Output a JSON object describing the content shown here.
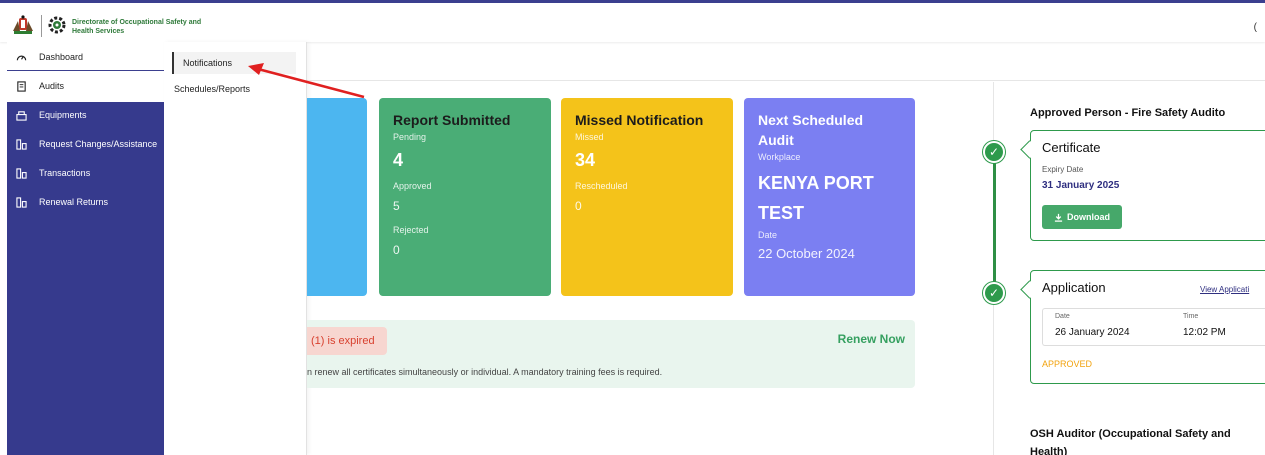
{
  "header": {
    "org_name": "Directorate of Occupational Safety and Health Services",
    "right_mark": "("
  },
  "sidebar": {
    "items": [
      {
        "label": "Dashboard",
        "icon": "gauge-icon"
      },
      {
        "label": "Audits",
        "icon": "document-icon"
      },
      {
        "label": "Equipments",
        "icon": "equipment-icon"
      },
      {
        "label": "Request Changes/Assistance",
        "icon": "request-icon"
      },
      {
        "label": "Transactions",
        "icon": "transactions-icon"
      },
      {
        "label": "Renewal Returns",
        "icon": "renewal-icon"
      }
    ]
  },
  "flyout": {
    "items": [
      "Notifications",
      "Schedules/Reports"
    ]
  },
  "cards": {
    "report": {
      "title": "Report Submitted",
      "pending_label": "Pending",
      "pending_value": "4",
      "approved_label": "Approved",
      "approved_value": "5",
      "rejected_label": "Rejected",
      "rejected_value": "0"
    },
    "missed": {
      "title": "Missed Notification",
      "missed_label": "Missed",
      "missed_value": "34",
      "rescheduled_label": "Rescheduled",
      "rescheduled_value": "0"
    },
    "next": {
      "title": "Next Scheduled Audit",
      "workplace_label": "Workplace",
      "workplace_value": "KENYA PORT TEST",
      "date_label": "Date",
      "date_value": "22 October 2024"
    }
  },
  "renewal": {
    "expired_text": "(1) is expired",
    "action": "Renew Now",
    "description": "n renew all certificates simultaneously or individual. A mandatory training fees is required."
  },
  "timeline": {
    "section_title": "Approved Person - Fire Safety Audito",
    "certificate": {
      "title": "Certificate",
      "expiry_label": "Expiry Date",
      "expiry_value": "31 January 2025",
      "download_label": "Download"
    },
    "application": {
      "title": "Application",
      "view_link": "View Applicati",
      "date_label": "Date",
      "date_value": "26 January 2024",
      "time_label": "Time",
      "time_value": "12:02 PM",
      "status": "APPROVED"
    },
    "next_section_title": "OSH Auditor (Occupational Safety and Health)"
  },
  "colors": {
    "sidebar": "#363a8d",
    "report_card": "#4aad76",
    "missed_card": "#f4c31a",
    "next_card": "#7b7ff2",
    "blue_card": "#4cb6f0",
    "timeline_green": "#2e9a4c",
    "annotation_arrow": "#e02020"
  }
}
